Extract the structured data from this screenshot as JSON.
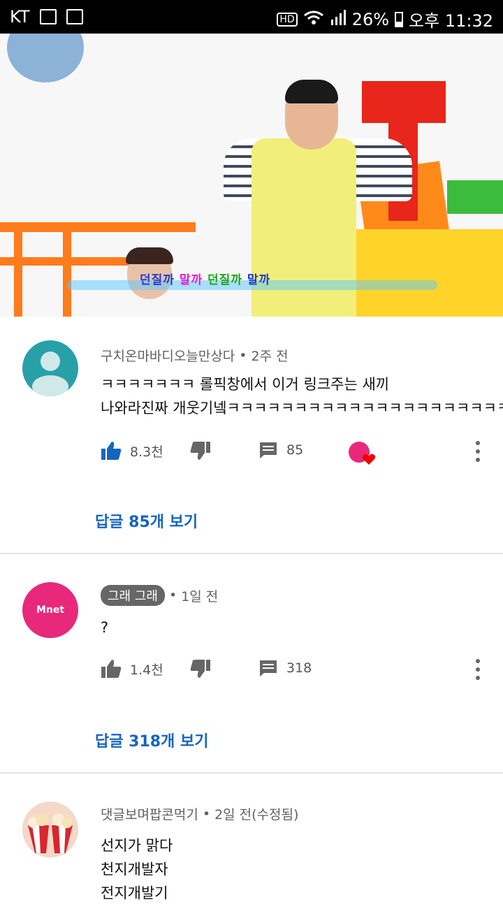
{
  "status_bar": {
    "carrier": "KT",
    "battery": "26%",
    "time": "오후 11:32",
    "network": "HD"
  },
  "video": {
    "caption_parts": [
      "던질까",
      "말까",
      "던질까",
      "말까"
    ]
  },
  "comments": [
    {
      "author": "구치온마바디오늘만상다",
      "time": "2주 전",
      "lines": [
        "ㅋㅋㅋㅋㅋㅋㅋ 롤픽창에서 이거 링크주는 새끼",
        "나와라진짜 개웃기넼ㅋㅋㅋㅋㅋㅋㅋㅋㅋㅋㅋㅋㅋㅋㅋㅋㅋㅋㅋㅋㅋㅋ"
      ],
      "likes": "8.3천",
      "reply_count": "85",
      "view_replies": "답글 85개 보기",
      "liked": true
    },
    {
      "author": "그래 그래",
      "time": "1일 전",
      "lines": [
        "?"
      ],
      "likes": "1.4천",
      "reply_count": "318",
      "view_replies": "답글 318개 보기",
      "avatar_text": "Mnet"
    },
    {
      "author": "댓글보며팝콘먹기",
      "time": "2일 전(수정됨)",
      "lines": [
        "선지가 맑다",
        "천지개발자",
        "전지개발기"
      ]
    }
  ],
  "colors": {
    "link": "#1565c0",
    "like_active": "#1565c0",
    "mnet_pink": "#e8287b",
    "avatar_teal": "#27a0a8"
  }
}
